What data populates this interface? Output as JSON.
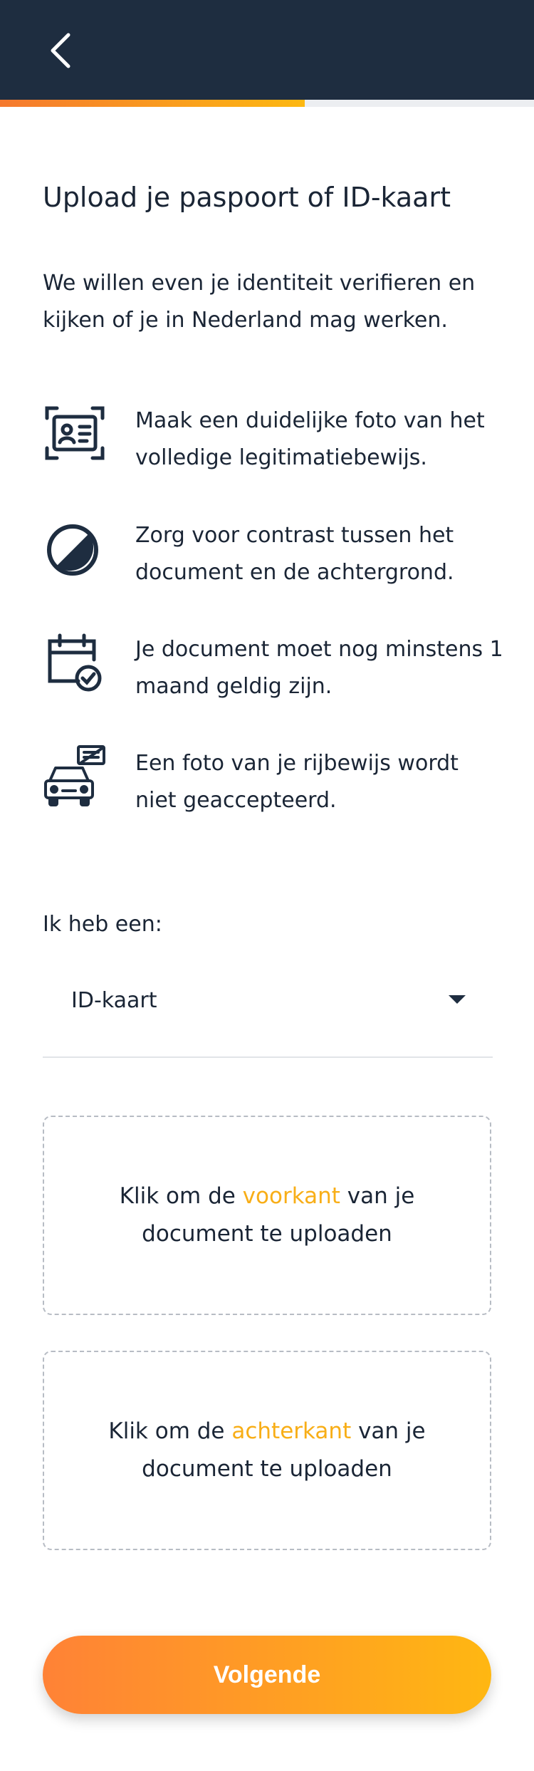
{
  "header": {
    "back_icon": "chevron-left-icon",
    "progress": 0.57,
    "colors": {
      "bar": "#1e2d40",
      "accent_start": "#f5792e",
      "accent_end": "#fdb811"
    }
  },
  "title": "Upload je paspoort of ID-kaart",
  "intro": "We willen even je identiteit verifieren en kijken of je in Nederland mag werken.",
  "tips": [
    {
      "icon": "id-card-scan-icon",
      "text": "Maak een duidelijke foto van het volledige legitimatiebewijs."
    },
    {
      "icon": "contrast-icon",
      "text": "Zorg voor contrast tussen het document en de achtergrond."
    },
    {
      "icon": "calendar-check-icon",
      "text": "Je document moet nog minstens 1 maand geldig zijn."
    },
    {
      "icon": "car-license-icon",
      "text": "Een foto van je rijbewijs wordt niet geaccepteerd."
    }
  ],
  "document": {
    "label": "Ik heb een:",
    "selected": "ID-kaart"
  },
  "uploads": {
    "front": {
      "before": "Klik om de ",
      "highlight": "voorkant",
      "after": " van je document te uploaden"
    },
    "back": {
      "before": "Klik om de ",
      "highlight": "achterkant",
      "after": " van je document te uploaden"
    }
  },
  "next_button": "Volgende"
}
